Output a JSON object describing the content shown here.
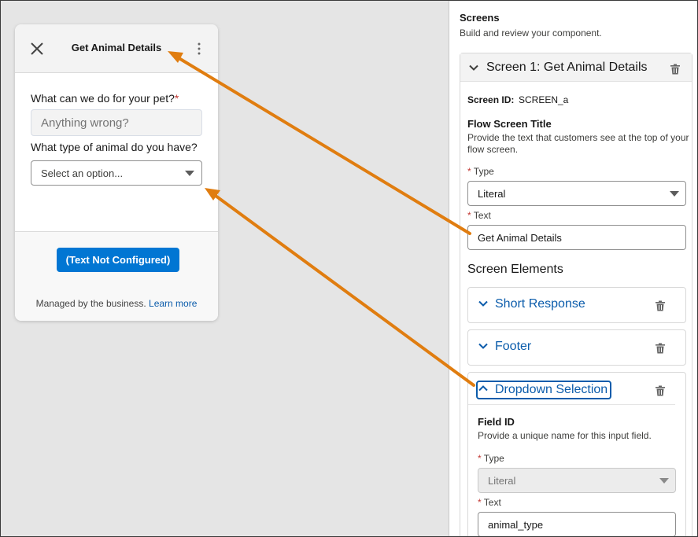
{
  "preview": {
    "title": "Get Animal Details",
    "question1_label": "What can we do for your pet?",
    "question1_required_mark": "*",
    "question1_placeholder": "Anything wrong?",
    "question2_label": "What type of animal do you have?",
    "question2_select_value": "Select an option...",
    "button_label": "(Text Not Configured)",
    "managed_text": "Managed by the business.",
    "learn_more_link": "Learn more"
  },
  "panel": {
    "title": "Screens",
    "subtitle": "Build and review your component.",
    "screen": {
      "title": "Screen 1: Get Animal Details",
      "screen_id_label": "Screen ID:",
      "screen_id_value": "SCREEN_a",
      "flow_title_heading": "Flow Screen Title",
      "flow_title_description": "Provide the text that customers see at the top of your flow screen.",
      "type_label": "Type",
      "type_value": "Literal",
      "text_label": "Text",
      "text_value": "Get Animal Details",
      "required_mark": "*",
      "elements_heading": "Screen Elements",
      "elements": [
        {
          "label": "Short Response"
        },
        {
          "label": "Footer"
        }
      ],
      "dropdown": {
        "label": "Dropdown Selection",
        "field_id_heading": "Field ID",
        "field_id_description": "Provide a unique name for this input field.",
        "type_label": "Type",
        "type_value": "Literal",
        "text_label": "Text",
        "text_value": "animal_type"
      }
    }
  },
  "colors": {
    "brand_button": "#0176d3",
    "link": "#0b5cab",
    "callout_arrow": "#e07d10",
    "required": "#c23934"
  }
}
